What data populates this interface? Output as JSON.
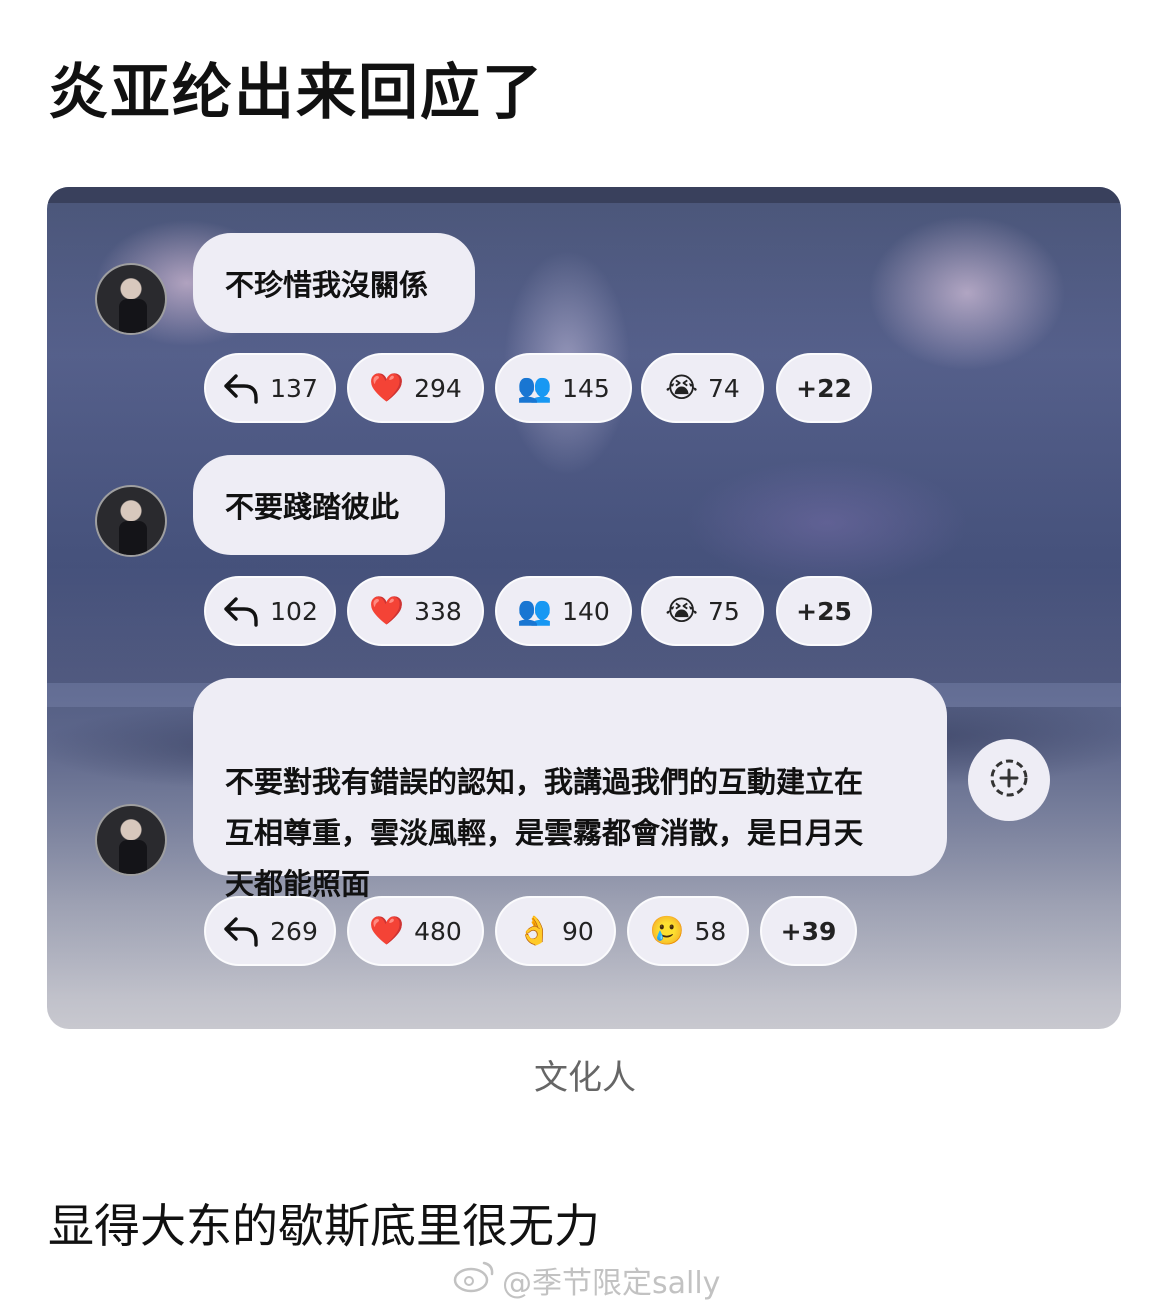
{
  "header": {
    "title": "炎亚纶出来回应了"
  },
  "messages": [
    {
      "text": "不珍惜我沒關係",
      "reactions": {
        "reply": "137",
        "heart": "294",
        "people": "145",
        "cry": "74",
        "more": "+22"
      }
    },
    {
      "text": "不要踐踏彼此",
      "reactions": {
        "reply": "102",
        "heart": "338",
        "people": "140",
        "cry": "75",
        "more": "+25"
      }
    },
    {
      "text": "不要對我有錯誤的認知，我講過我們的互動建立在\n互相尊重，雲淡風輕，是雲霧都會消散，是日月天\n天都能照面",
      "reactions": {
        "reply": "269",
        "heart": "480",
        "ok": "90",
        "sad": "58",
        "more": "+39"
      }
    }
  ],
  "emoji": {
    "heart": "❤️",
    "people": "👥",
    "cry": "😭",
    "ok": "👌",
    "sad": "🥲"
  },
  "caption": "文化人",
  "footer": {
    "subtitle": "显得大东的歇斯底里很无力",
    "watermark": "@季节限定sally"
  },
  "colors": {
    "bubble": "#eeedf5",
    "caption": "#666666",
    "screenshot_top": "#4a5578"
  }
}
